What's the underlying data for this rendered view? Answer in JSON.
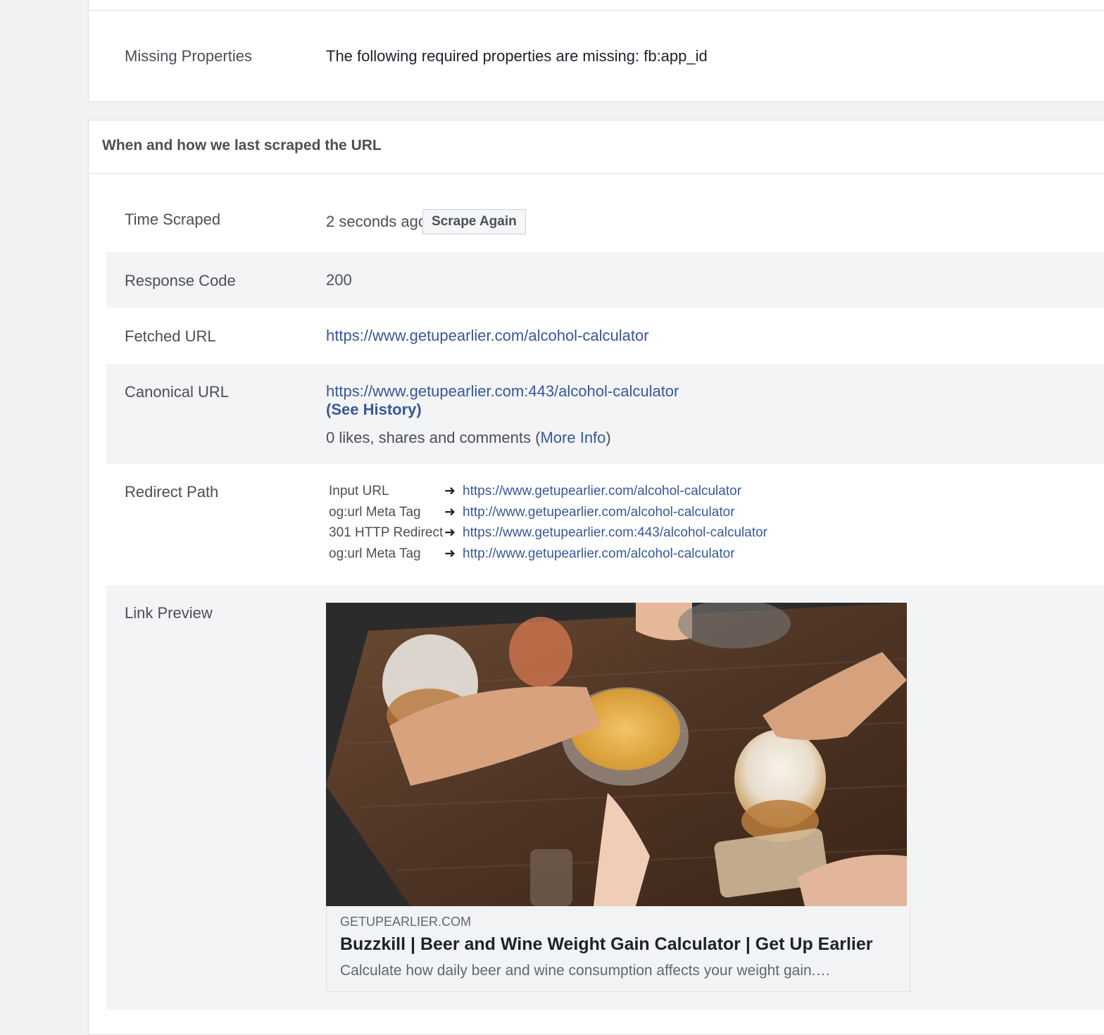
{
  "missing_properties": {
    "label": "Missing Properties",
    "value": "The following required properties are missing: fb:app_id"
  },
  "scrape_section": {
    "title": "When and how we last scraped the URL",
    "time_scraped": {
      "label": "Time Scraped",
      "value": "2 seconds ago",
      "button": "Scrape Again"
    },
    "response_code": {
      "label": "Response Code",
      "value": "200"
    },
    "fetched_url": {
      "label": "Fetched URL",
      "value": "https://www.getupearlier.com/alcohol-calculator"
    },
    "canonical_url": {
      "label": "Canonical URL",
      "value": "https://www.getupearlier.com:443/alcohol-calculator",
      "see_history": "(See History)",
      "engagement_text": "0 likes, shares and comments (",
      "more_info": "More Info",
      "engagement_close": ")"
    },
    "redirect_path": {
      "label": "Redirect Path",
      "arrow_icon": "right-arrow-icon",
      "steps": [
        {
          "type": "Input URL",
          "url": "https://www.getupearlier.com/alcohol-calculator"
        },
        {
          "type": "og:url Meta Tag",
          "url": "http://www.getupearlier.com/alcohol-calculator"
        },
        {
          "type": "301 HTTP Redirect",
          "url": "https://www.getupearlier.com:443/alcohol-calculator"
        },
        {
          "type": "og:url Meta Tag",
          "url": "http://www.getupearlier.com/alcohol-calculator"
        }
      ]
    },
    "link_preview": {
      "label": "Link Preview",
      "domain": "GETUPEARLIER.COM",
      "title": "Buzzkill | Beer and Wine Weight Gain Calculator | Get Up Earlier",
      "description": "Calculate how daily beer and wine consumption affects your weight gain.…"
    }
  },
  "colors": {
    "link": "#385898",
    "alt_row": "#f3f4f6",
    "page_bg": "#f2f2f2",
    "border": "#dddfe2"
  }
}
